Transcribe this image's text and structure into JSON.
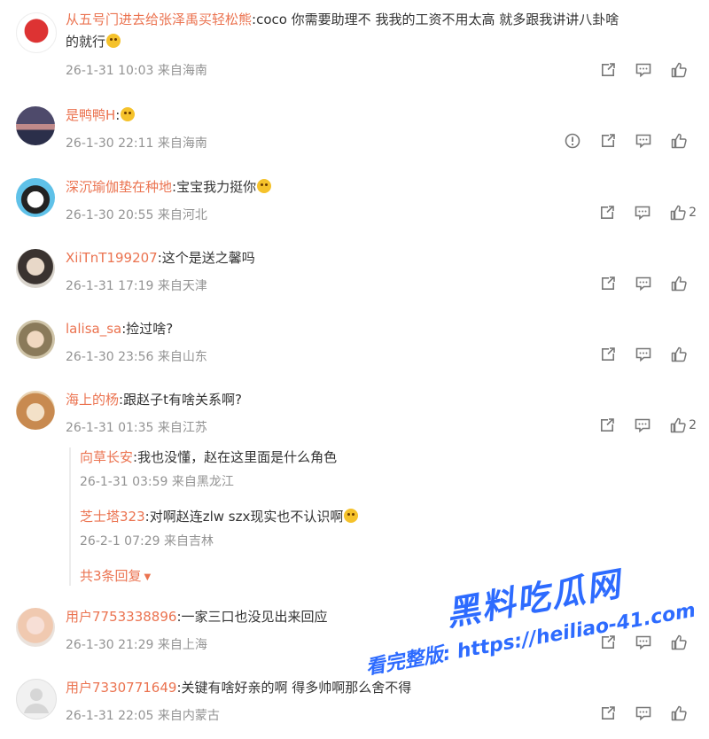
{
  "comments": [
    {
      "user": "从五号门进去给张泽禹买轻松熊",
      "text": ":coco 你需要助理不 我我的工资不用太高 就多跟我讲讲八卦啥",
      "text2": "的就行",
      "meta": "26-1-31 10:03 来自海南",
      "likes": ""
    },
    {
      "user": "是鸭鸭H",
      "text": ":",
      "meta": "26-1-30 22:11 来自海南",
      "likes": ""
    },
    {
      "user": "深沉瑜伽垫在种地",
      "text": ":宝宝我力挺你",
      "meta": "26-1-30 20:55 来自河北",
      "likes": "2"
    },
    {
      "user": "XiiTnT199207",
      "text": ":这个是送之馨吗",
      "meta": "26-1-31 17:19 来自天津",
      "likes": ""
    },
    {
      "user": "lalisa_sa",
      "text": ":捡过啥?",
      "meta": "26-1-30 23:56 来自山东",
      "likes": ""
    },
    {
      "user": "海上的杨",
      "text": ":跟赵子t有啥关系啊?",
      "meta": "26-1-31 01:35 来自江苏",
      "likes": "2"
    },
    {
      "user": "用户7753338896",
      "text": ":一家三口也没见出来回应",
      "meta": "26-1-30 21:29 来自上海",
      "likes": ""
    },
    {
      "user": "用户7330771649",
      "text": ":关键有啥好亲的啊 得多帅啊那么舍不得",
      "meta": "26-1-31 22:05 来自内蒙古",
      "likes": ""
    }
  ],
  "replies": [
    {
      "user": "向草长安",
      "text": ":我也没懂，赵在这里面是什么角色",
      "meta": "26-1-31 03:59 来自黑龙江"
    },
    {
      "user": "芝士塔323",
      "text": ":对啊赵连zlw szx现实也不认识啊",
      "meta": "26-2-1 07:29 来自吉林"
    }
  ],
  "more_replies": "共3条回复",
  "watermark": {
    "title": "黑料吃瓜网",
    "subtitle": "看完整版: https://heiliao-41.com"
  },
  "colors": {
    "username": "#eb7350",
    "meta": "#939393",
    "text": "#333333",
    "watermark": "#2d6bff"
  }
}
